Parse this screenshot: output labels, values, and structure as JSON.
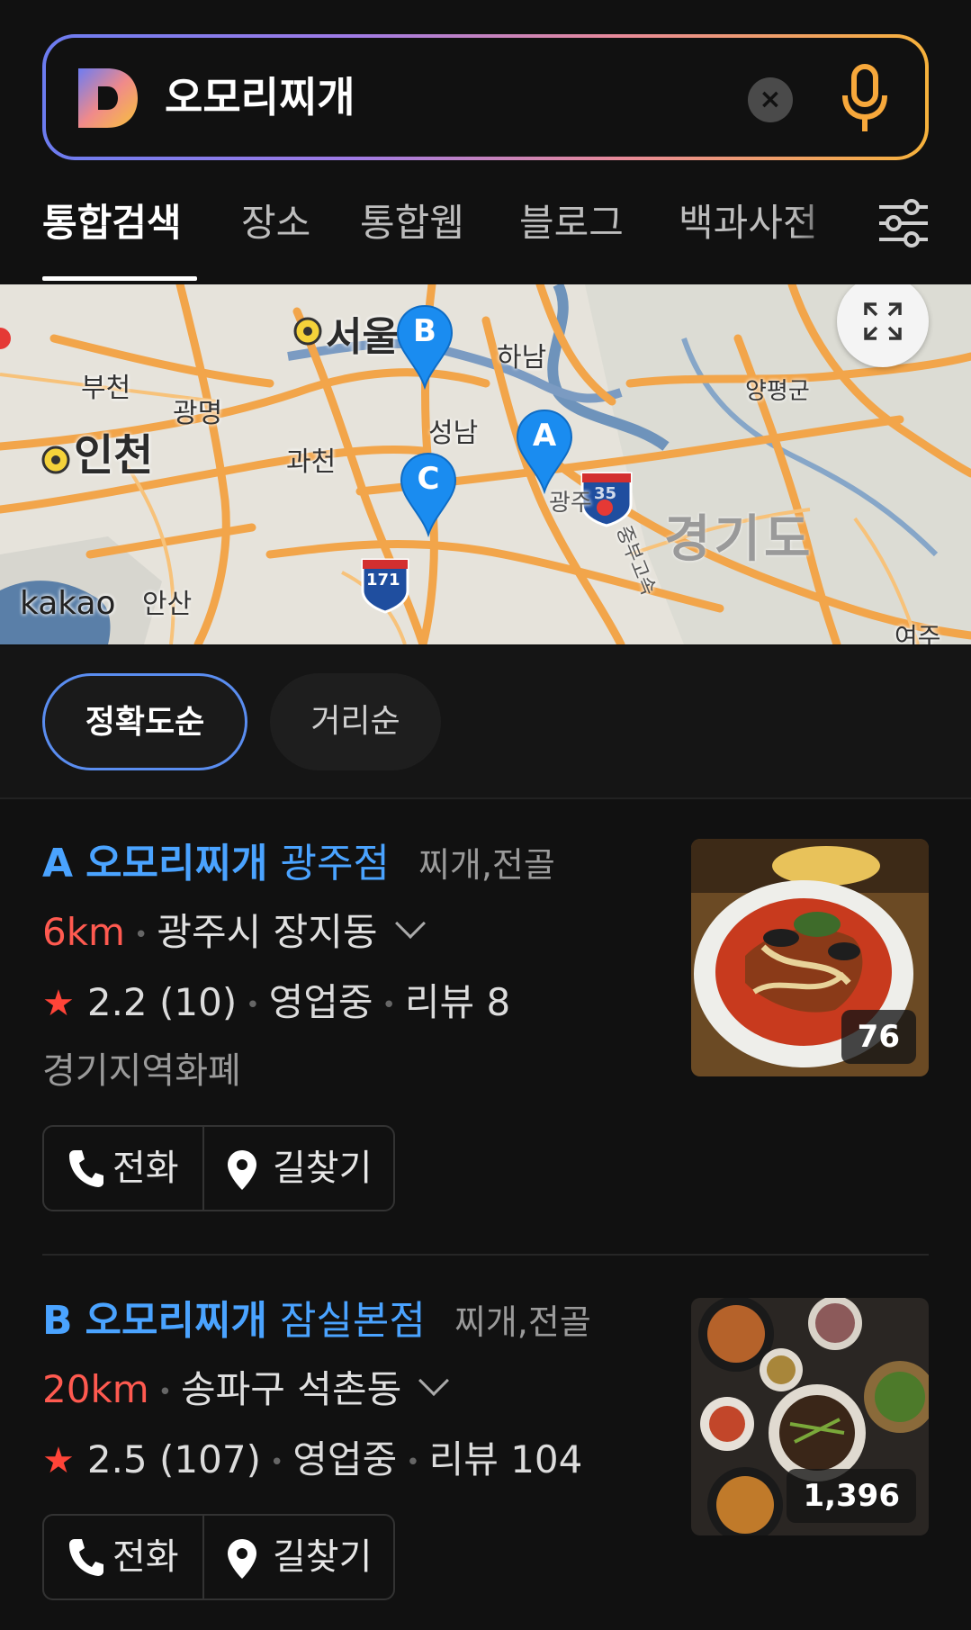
{
  "search": {
    "query": "오모리찌개",
    "clear_label": "×"
  },
  "tabs": [
    {
      "label": "통합검색",
      "active": true
    },
    {
      "label": "장소"
    },
    {
      "label": "통합웹"
    },
    {
      "label": "블로그"
    },
    {
      "label": "백과사전"
    }
  ],
  "map": {
    "places": {
      "seoul": "서울",
      "hanam": "하남",
      "bucheon": "부천",
      "gwangmyeong": "광명",
      "incheon": "인천",
      "gwacheon": "과천",
      "seongnam": "성남",
      "yangpyeong": "양평군",
      "gyeonggi": "경기도",
      "ansan": "안산",
      "yeoju": "여주",
      "gwangju_partial": "광주",
      "expressway": "중부고속"
    },
    "watermark": "kakao",
    "route_shields": [
      "171",
      "35"
    ],
    "pins": [
      "A",
      "B",
      "C"
    ],
    "colors": {
      "pin": "#1a8cf0",
      "road": "#f3a54a",
      "land": "#e8e5de"
    }
  },
  "sort": {
    "options": [
      "정확도순",
      "거리순"
    ],
    "selected": "정확도순"
  },
  "results": [
    {
      "marker": "A",
      "name": "오모리찌개",
      "branch": "광주점",
      "category": "찌개,전골",
      "distance": "6km",
      "address": "광주시 장지동",
      "rating": "2.2",
      "rating_count": "(10)",
      "status": "영업중",
      "reviews": "리뷰 8",
      "extra": "경기지역화폐",
      "photo_count": "76",
      "call_label": "전화",
      "route_label": "길찾기"
    },
    {
      "marker": "B",
      "name": "오모리찌개",
      "branch": "잠실본점",
      "category": "찌개,전골",
      "distance": "20km",
      "address": "송파구 석촌동",
      "rating": "2.5",
      "rating_count": "(107)",
      "status": "영업중",
      "reviews": "리뷰 104",
      "photo_count": "1,396",
      "call_label": "전화",
      "route_label": "길찾기"
    }
  ],
  "colors": {
    "background": "#111111",
    "link_blue": "#4aa3ff",
    "distance_red": "#ff5a50",
    "star_red": "#ff4438",
    "sort_active_border": "#5a8df0"
  }
}
